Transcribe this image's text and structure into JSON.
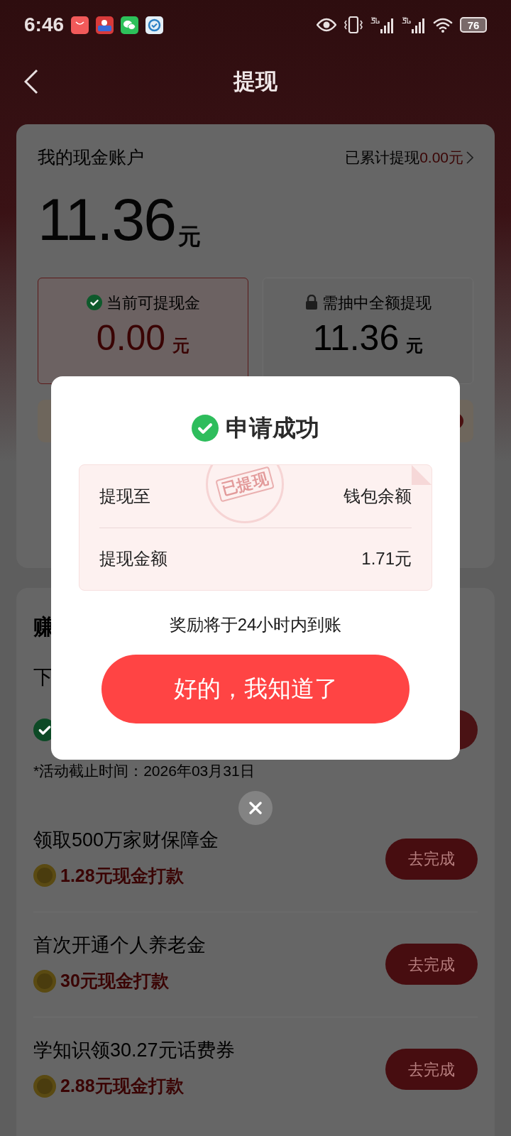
{
  "status_bar": {
    "time": "6:46",
    "battery": "76"
  },
  "header": {
    "title": "提现"
  },
  "account": {
    "title": "我的现金账户",
    "withdrawn_label": "已累计提现",
    "withdrawn_value": "0.00元",
    "balance": "11.36",
    "balance_unit": "元"
  },
  "boxes": [
    {
      "kind": "available",
      "label": "当前可提现金",
      "value": "0.00",
      "unit": "元"
    },
    {
      "kind": "locked",
      "label": "需抽中全额提现",
      "value": "11.36",
      "unit": "元"
    }
  ],
  "earn_section": {
    "title_fragment": "赚",
    "item_fragment": "下",
    "deadline": "*活动截止时间：2026年03月31日"
  },
  "tasks": [
    {
      "title": "领取500万家财保障金",
      "reward": "1.28元现金打款",
      "button": "去完成"
    },
    {
      "title": "首次开通个人养老金",
      "reward": "30元现金打款",
      "button": "去完成"
    },
    {
      "title": "学知识领30.27元话费券",
      "reward": "2.88元现金打款",
      "button": "去完成"
    }
  ],
  "dialog": {
    "title": "申请成功",
    "stamp": "已提现",
    "rows": [
      {
        "label": "提现至",
        "value": "钱包余额"
      },
      {
        "label": "提现金额",
        "value": "1.71元"
      }
    ],
    "note": "奖励将于24小时内到账",
    "confirm_button": "好的，我知道了"
  }
}
